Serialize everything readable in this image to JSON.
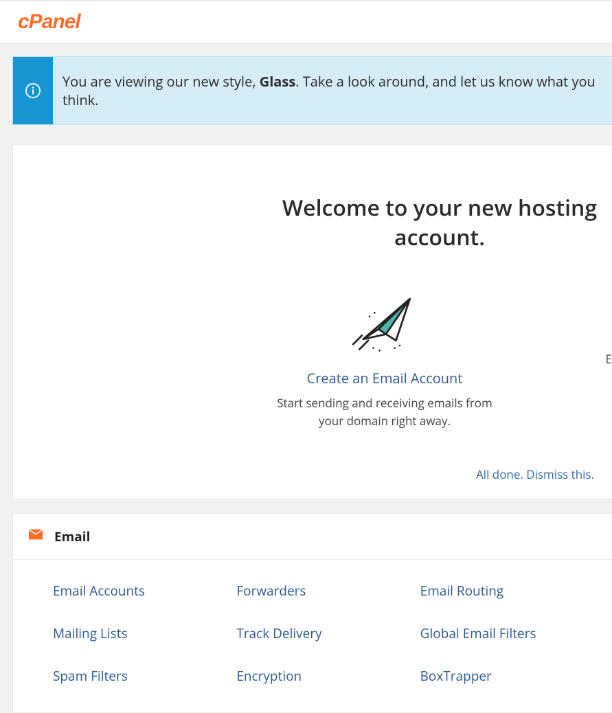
{
  "header": {
    "logo_text": "cPanel"
  },
  "banner": {
    "prefix": "You are viewing our new style, ",
    "style_name": "Glass",
    "suffix": ". Take a look around, and let us know what you think."
  },
  "welcome": {
    "title": "Welcome to your new hosting account.",
    "create_link": "Create an Email Account",
    "create_desc_line1": "Start sending and receiving emails from",
    "create_desc_line2": "your domain right away.",
    "side_fragment": "E",
    "dismiss": "All done. Dismiss this."
  },
  "email_section": {
    "title": "Email",
    "items": [
      "Email Accounts",
      "Forwarders",
      "Email Routing",
      "Mailing Lists",
      "Track Delivery",
      "Global Email Filters",
      "Spam Filters",
      "Encryption",
      "BoxTrapper"
    ]
  }
}
